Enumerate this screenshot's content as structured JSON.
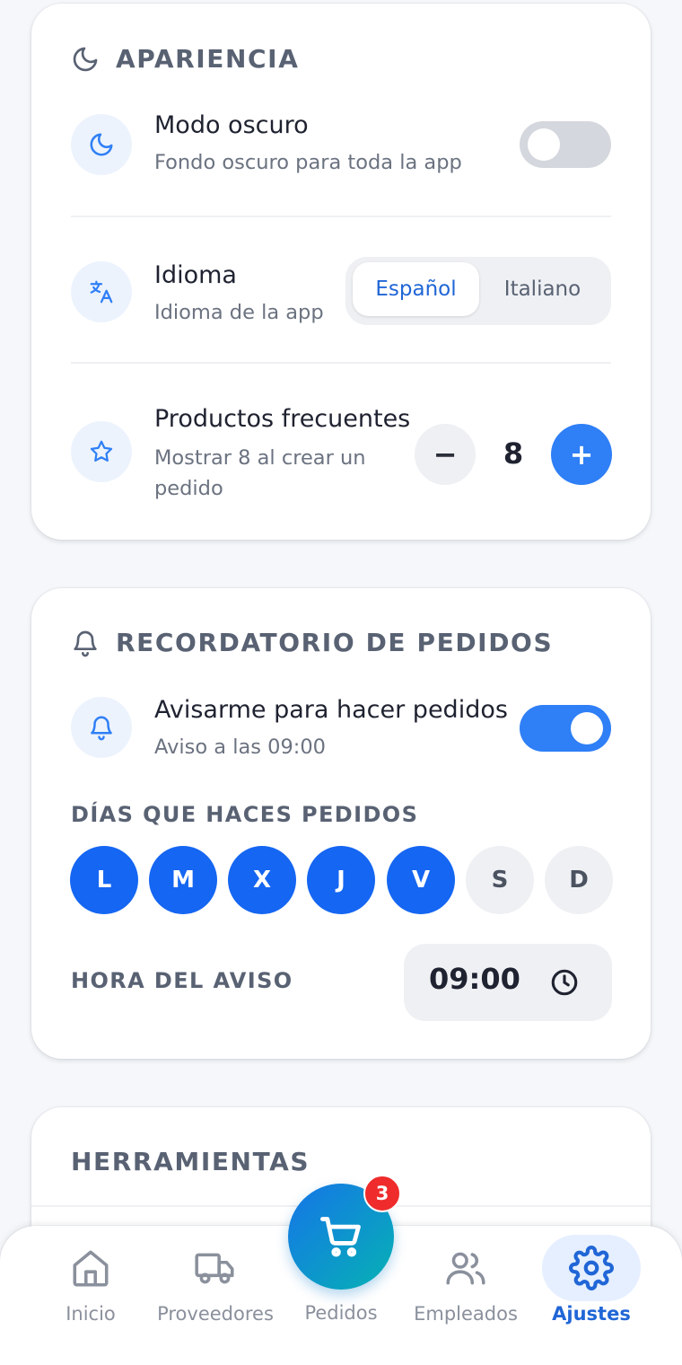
{
  "appearance": {
    "title": "APARIENCIA",
    "dark_mode": {
      "title": "Modo oscuro",
      "subtitle": "Fondo oscuro para toda la app",
      "enabled": false
    },
    "language": {
      "title": "Idioma",
      "subtitle": "Idioma de la app",
      "options": [
        "Español",
        "Italiano"
      ],
      "selected": "Español"
    },
    "frequent_products": {
      "title": "Productos frecuentes",
      "subtitle_line1": "Mostrar 8 al crear un",
      "subtitle_line2": "pedido",
      "minus_label": "−",
      "value": "8",
      "plus_label": "+"
    }
  },
  "reminder": {
    "title": "RECORDATORIO DE PEDIDOS",
    "notify": {
      "title": "Avisarme para hacer pedidos",
      "subtitle": "Aviso a las 09:00",
      "enabled": true
    },
    "days_label": "DÍAS QUE HACES PEDIDOS",
    "days": [
      {
        "label": "L",
        "selected": true
      },
      {
        "label": "M",
        "selected": true
      },
      {
        "label": "X",
        "selected": true
      },
      {
        "label": "J",
        "selected": true
      },
      {
        "label": "V",
        "selected": true
      },
      {
        "label": "S",
        "selected": false
      },
      {
        "label": "D",
        "selected": false
      }
    ],
    "time_label": "HORA DEL AVISO",
    "time_value": "09:00"
  },
  "tools": {
    "title": "HERRAMIENTAS"
  },
  "nav": {
    "items": [
      {
        "label": "Inicio",
        "icon": "home-icon",
        "active": false
      },
      {
        "label": "Proveedores",
        "icon": "truck-icon",
        "active": false
      },
      {
        "label": "Pedidos",
        "icon": "cart-icon",
        "active": false,
        "badge": "3"
      },
      {
        "label": "Empleados",
        "icon": "users-icon",
        "active": false
      },
      {
        "label": "Ajustes",
        "icon": "gear-icon",
        "active": true
      }
    ]
  },
  "colors": {
    "accent": "#2f7ff6",
    "day_selected": "#1566f2",
    "badge": "#ef2b2b",
    "nav_active": "#2066d6",
    "nav_inactive": "#8a909c"
  }
}
